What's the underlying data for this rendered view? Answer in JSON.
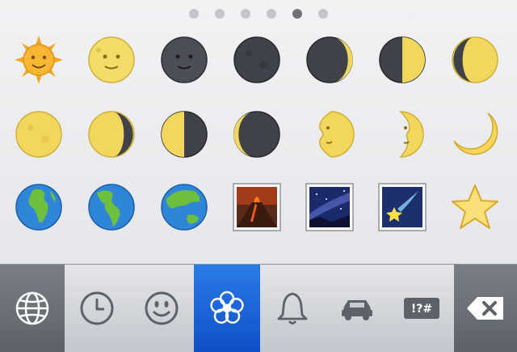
{
  "emoji_pager": {
    "page_count": 6,
    "current_page": 5
  },
  "emoji_grid": [
    {
      "name": "sun-with-face"
    },
    {
      "name": "full-moon-with-face"
    },
    {
      "name": "new-moon-with-face"
    },
    {
      "name": "new-moon"
    },
    {
      "name": "waxing-crescent-moon"
    },
    {
      "name": "first-quarter-moon"
    },
    {
      "name": "waxing-gibbous-moon"
    },
    {
      "name": "full-moon"
    },
    {
      "name": "waning-gibbous-moon"
    },
    {
      "name": "last-quarter-moon"
    },
    {
      "name": "waning-crescent-moon"
    },
    {
      "name": "first-quarter-moon-with-face"
    },
    {
      "name": "last-quarter-moon-with-face"
    },
    {
      "name": "crescent-moon"
    },
    {
      "name": "earth-globe-europe-africa"
    },
    {
      "name": "earth-globe-americas"
    },
    {
      "name": "earth-globe-asia-australia"
    },
    {
      "name": "volcano"
    },
    {
      "name": "milky-way"
    },
    {
      "name": "shooting-star"
    },
    {
      "name": "star"
    }
  ],
  "toolbar": {
    "tabs": [
      {
        "name": "globe-icon"
      },
      {
        "name": "clock-icon"
      },
      {
        "name": "smiley-icon"
      },
      {
        "name": "flower-icon",
        "selected": true
      },
      {
        "name": "bell-icon"
      },
      {
        "name": "car-icon"
      },
      {
        "name": "symbols-icon",
        "label": "!?#"
      },
      {
        "name": "delete-icon"
      }
    ]
  },
  "colors": {
    "active_tab": "#1560d8",
    "moon_yellow": "#f3d65c",
    "moon_dark": "#3f4249"
  }
}
